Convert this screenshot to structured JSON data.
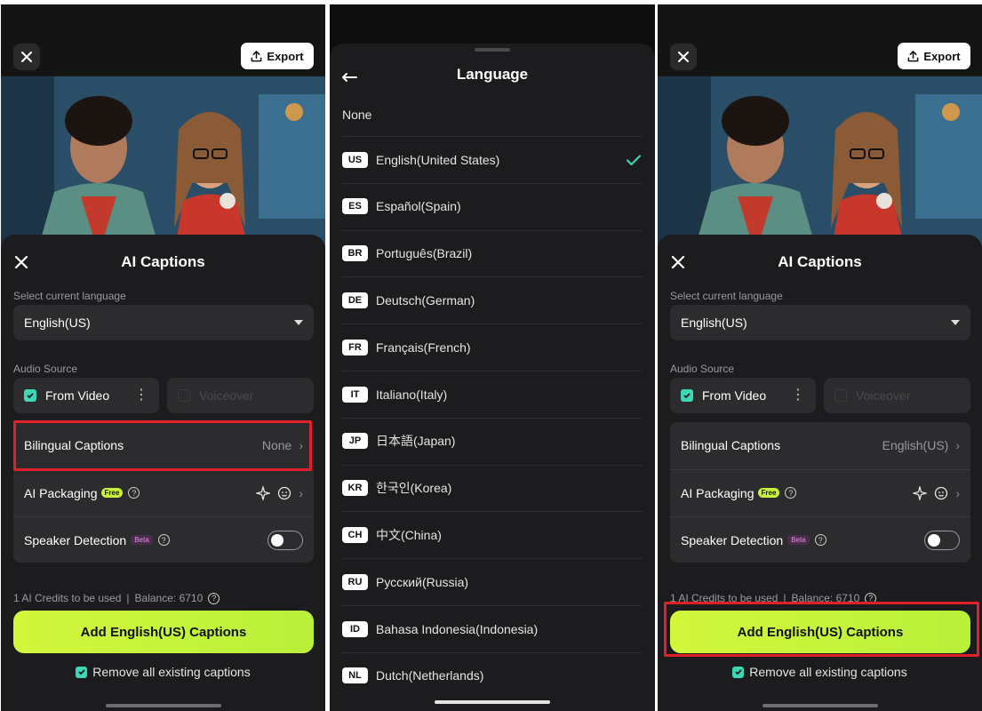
{
  "colors": {
    "accent": "#c9f33a",
    "check": "#3ed6b5",
    "highlight": "#e0202a"
  },
  "export_label": "Export",
  "panel1": {
    "title": "AI Captions",
    "select_language_label": "Select current language",
    "selected_language": "English(US)",
    "audio_source_label": "Audio Source",
    "from_video": "From Video",
    "voiceover": "Voiceover",
    "bilingual_label": "Bilingual Captions",
    "bilingual_value": "None",
    "ai_packaging_label": "AI Packaging",
    "free_badge": "Free",
    "speaker_detection_label": "Speaker Detection",
    "beta_badge": "Beta",
    "credits": "1 AI Credits to be used",
    "balance": "Balance: 6710",
    "cta": "Add English(US) Captions",
    "remove_label": "Remove all existing captions"
  },
  "panel2": {
    "title": "Language",
    "none_label": "None",
    "languages": [
      {
        "code": "US",
        "name": "English(United States)",
        "selected": true
      },
      {
        "code": "ES",
        "name": "Español(Spain)"
      },
      {
        "code": "BR",
        "name": "Português(Brazil)"
      },
      {
        "code": "DE",
        "name": "Deutsch(German)"
      },
      {
        "code": "FR",
        "name": "Français(French)"
      },
      {
        "code": "IT",
        "name": "Italiano(Italy)"
      },
      {
        "code": "JP",
        "name": "日本語(Japan)"
      },
      {
        "code": "KR",
        "name": "한국인(Korea)"
      },
      {
        "code": "CH",
        "name": "中文(China)"
      },
      {
        "code": "RU",
        "name": "Русский(Russia)"
      },
      {
        "code": "ID",
        "name": "Bahasa Indonesia(Indonesia)"
      },
      {
        "code": "NL",
        "name": "Dutch(Netherlands)"
      }
    ]
  },
  "panel3": {
    "title": "AI Captions",
    "select_language_label": "Select current language",
    "selected_language": "English(US)",
    "audio_source_label": "Audio Source",
    "from_video": "From Video",
    "voiceover": "Voiceover",
    "bilingual_label": "Bilingual Captions",
    "bilingual_value": "English(US)",
    "ai_packaging_label": "AI Packaging",
    "free_badge": "Free",
    "speaker_detection_label": "Speaker Detection",
    "beta_badge": "Beta",
    "credits": "1 AI Credits to be used",
    "balance": "Balance: 6710",
    "cta": "Add English(US) Captions",
    "remove_label": "Remove all existing captions"
  }
}
